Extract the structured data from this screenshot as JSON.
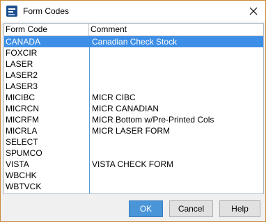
{
  "window": {
    "title": "Form Codes",
    "border_color": "#c88a3a"
  },
  "icons": {
    "app": "form-codes-app-icon",
    "close": "close-icon"
  },
  "table": {
    "columns": [
      "Form Code",
      "Comment"
    ],
    "selected_index": 0,
    "selection_color": "#3d8ee6",
    "rows": [
      {
        "code": "CANADA",
        "comment": "Canadian Check Stock"
      },
      {
        "code": "FOXCIR",
        "comment": ""
      },
      {
        "code": "LASER",
        "comment": ""
      },
      {
        "code": "LASER2",
        "comment": ""
      },
      {
        "code": "LASER3",
        "comment": ""
      },
      {
        "code": "MICIBC",
        "comment": "MICR CIBC"
      },
      {
        "code": "MICRCN",
        "comment": "MICR CANADIAN"
      },
      {
        "code": "MICRFM",
        "comment": "MICR Bottom w/Pre-Printed Cols"
      },
      {
        "code": "MICRLA",
        "comment": "MICR LASER FORM"
      },
      {
        "code": "SELECT",
        "comment": ""
      },
      {
        "code": "SPUMCO",
        "comment": ""
      },
      {
        "code": "VISTA",
        "comment": "VISTA CHECK FORM"
      },
      {
        "code": "WBCHK",
        "comment": ""
      },
      {
        "code": "WBTVCK",
        "comment": ""
      }
    ]
  },
  "buttons": {
    "ok": "OK",
    "cancel": "Cancel",
    "help": "Help"
  }
}
